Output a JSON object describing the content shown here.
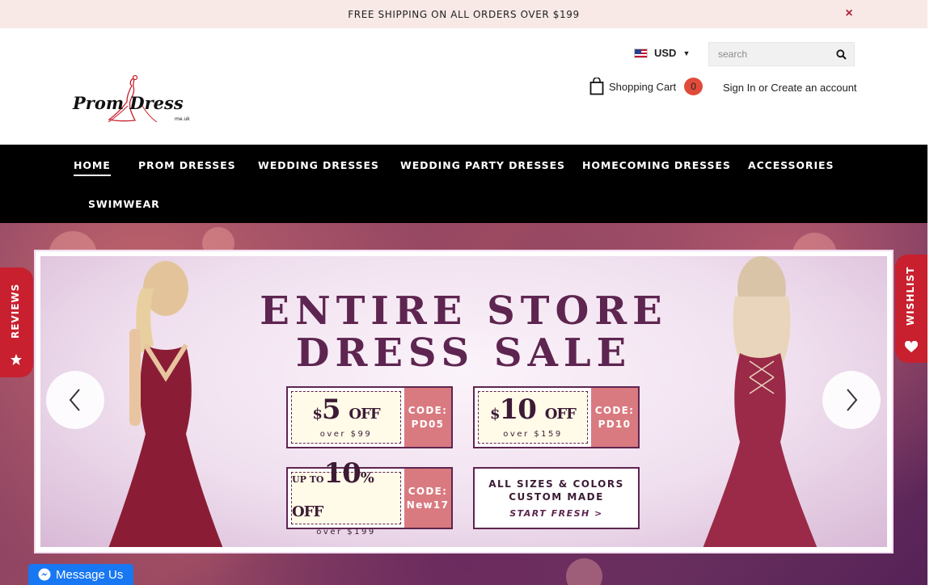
{
  "announcement": {
    "text": "FREE SHIPPING ON ALL ORDERS OVER $199",
    "close": "×"
  },
  "header": {
    "logo_text": "Prom Dress",
    "logo_suffix": "me.uk",
    "currency": "USD",
    "search_placeholder": "search",
    "cart_label": "Shopping Cart",
    "cart_count": "0",
    "sign_in": "Sign In",
    "or": "or",
    "create_account": "Create an account"
  },
  "nav": {
    "items": [
      {
        "label": "HOME",
        "active": true
      },
      {
        "label": "PROM DRESSES"
      },
      {
        "label": "WEDDING DRESSES"
      },
      {
        "label": "WEDDING PARTY DRESSES"
      },
      {
        "label": "HOMECOMING DRESSES"
      },
      {
        "label": "ACCESSORIES"
      },
      {
        "label": "SWIMWEAR"
      }
    ]
  },
  "hero": {
    "headline_1": "ENTIRE STORE",
    "headline_2": "DRESS SALE",
    "coupons": [
      {
        "prefix": "$",
        "amount": "5",
        "off": "OFF",
        "min": "over $99",
        "code_label": "CODE:",
        "code": "PD05"
      },
      {
        "prefix": "$",
        "amount": "10",
        "off": "OFF",
        "min": "over $159",
        "code_label": "CODE:",
        "code": "PD10"
      },
      {
        "prefix": "UP TO",
        "amount": "10",
        "suffix": "%",
        "off": "OFF",
        "min": "over $199",
        "code_label": "CODE:",
        "code": "New17"
      }
    ],
    "custom": {
      "line1": "ALL SIZES & COLORS",
      "line2": "CUSTOM MADE",
      "line3": "START FRESH >"
    }
  },
  "side_tabs": {
    "reviews": "REVIEWS",
    "wishlist": "WISHLIST"
  },
  "messenger": {
    "label": "Message Us"
  },
  "colors": {
    "accent_red": "#c8202e",
    "nav_bg": "#000000",
    "announce_bg": "#f8e9e7",
    "brand_plum": "#5e2550",
    "cart_badge": "#e14b3b"
  }
}
